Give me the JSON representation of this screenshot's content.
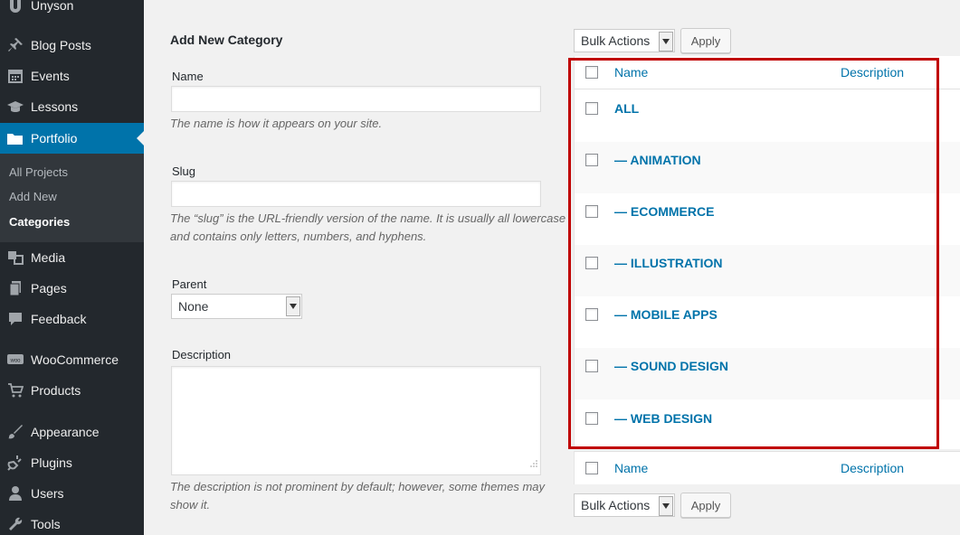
{
  "sidebar": {
    "top_item": "Unyson",
    "items": [
      {
        "label": "Blog Posts",
        "icon": "pin-icon"
      },
      {
        "label": "Events",
        "icon": "calendar-icon"
      },
      {
        "label": "Lessons",
        "icon": "graduation-cap-icon"
      },
      {
        "label": "Portfolio",
        "icon": "folder-icon",
        "active": true
      },
      {
        "label": "Media",
        "icon": "media-icon"
      },
      {
        "label": "Pages",
        "icon": "pages-icon"
      },
      {
        "label": "Feedback",
        "icon": "comment-icon"
      },
      {
        "label": "WooCommerce",
        "icon": "woo-icon"
      },
      {
        "label": "Products",
        "icon": "cart-icon"
      },
      {
        "label": "Appearance",
        "icon": "brush-icon"
      },
      {
        "label": "Plugins",
        "icon": "plug-icon"
      },
      {
        "label": "Users",
        "icon": "user-icon"
      },
      {
        "label": "Tools",
        "icon": "wrench-icon"
      }
    ],
    "submenu": [
      "All Projects",
      "Add New",
      "Categories"
    ],
    "submenu_current": "Categories"
  },
  "form": {
    "title": "Add New Category",
    "name_label": "Name",
    "name_value": "",
    "name_help": "The name is how it appears on your site.",
    "slug_label": "Slug",
    "slug_value": "",
    "slug_help": "The “slug” is the URL-friendly version of the name. It is usually all lowercase and contains only letters, numbers, and hyphens.",
    "parent_label": "Parent",
    "parent_value": "None",
    "description_label": "Description",
    "description_value": "",
    "description_help": "The description is not prominent by default; however, some themes may show it."
  },
  "table": {
    "bulk_actions": "Bulk Actions",
    "apply": "Apply",
    "columns": {
      "name": "Name",
      "description": "Description"
    },
    "rows": [
      {
        "name": "ALL",
        "description": ""
      },
      {
        "name": "— ANIMATION",
        "description": ""
      },
      {
        "name": "— ECOMMERCE",
        "description": ""
      },
      {
        "name": "— ILLUSTRATION",
        "description": ""
      },
      {
        "name": "— MOBILE APPS",
        "description": ""
      },
      {
        "name": "— SOUND DESIGN",
        "description": ""
      },
      {
        "name": "— WEB DESIGN",
        "description": ""
      }
    ]
  },
  "colors": {
    "sidebar_bg": "#23282d",
    "active_bg": "#0073aa",
    "link": "#0073aa",
    "highlight": "#c00000"
  }
}
